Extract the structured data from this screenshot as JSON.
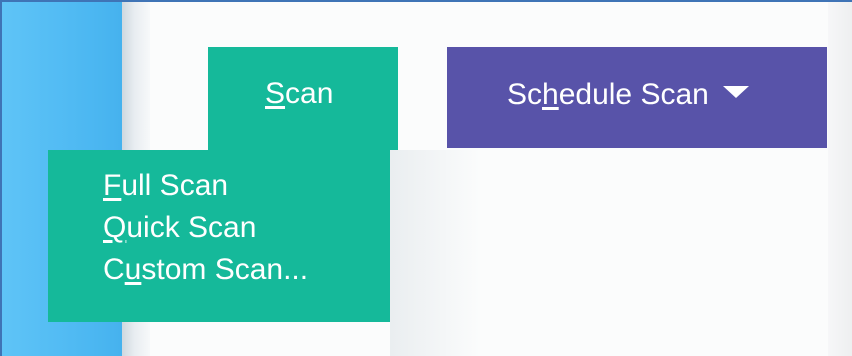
{
  "toolbar": {
    "scan_button": {
      "mnemonic": "S",
      "rest": "can"
    },
    "schedule_button": {
      "pre": "Sc",
      "mnemonic": "h",
      "rest": "edule Scan",
      "icon": "caret-down-icon"
    }
  },
  "scan_menu": {
    "items": [
      {
        "pre": "",
        "mnemonic": "F",
        "rest": "ull Scan"
      },
      {
        "pre": "",
        "mnemonic": "Q",
        "rest": "uick Scan"
      },
      {
        "pre": "C",
        "mnemonic": "u",
        "rest": "stom Scan..."
      }
    ]
  },
  "colors": {
    "scan_green": "#15b99a",
    "schedule_purple": "#5853a9",
    "sidebar_blue": "#4db8f2",
    "border_blue": "#3f74b6",
    "text_white": "#ffffff"
  }
}
